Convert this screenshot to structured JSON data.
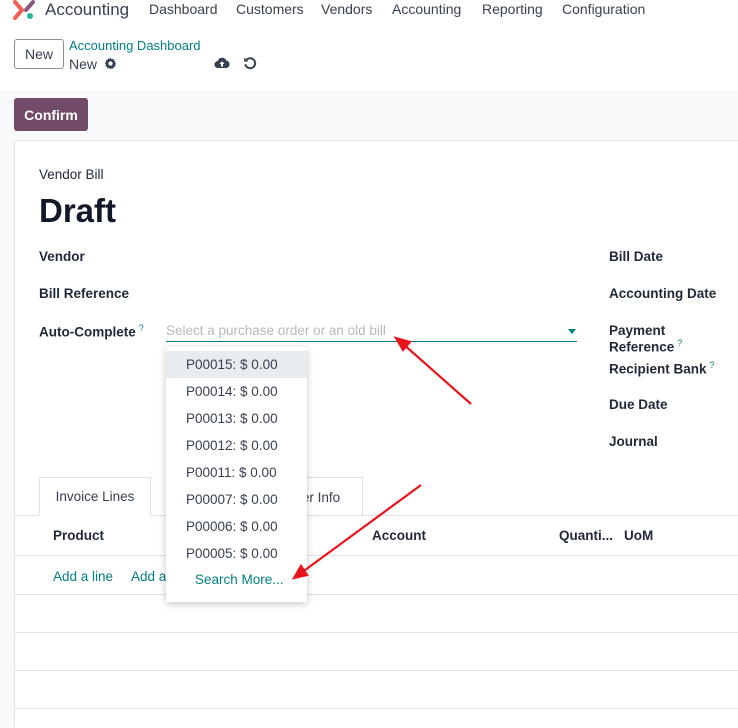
{
  "navbar": {
    "app_name": "Accounting",
    "items": [
      {
        "label": "Dashboard"
      },
      {
        "label": "Customers"
      },
      {
        "label": "Vendors"
      },
      {
        "label": "Accounting"
      },
      {
        "label": "Reporting"
      },
      {
        "label": "Configuration"
      }
    ]
  },
  "control": {
    "new_label": "New",
    "breadcrumb_parent": "Accounting Dashboard",
    "breadcrumb_current": "New"
  },
  "actions": {
    "confirm_label": "Confirm"
  },
  "form": {
    "doc_type": "Vendor Bill",
    "status_title": "Draft",
    "left_fields": {
      "vendor": "Vendor",
      "bill_reference": "Bill Reference",
      "auto_complete": "Auto-Complete",
      "auto_complete_help": "?"
    },
    "auto_complete_placeholder": "Select a purchase order or an old bill",
    "right_fields": {
      "bill_date": "Bill Date",
      "accounting_date": "Accounting Date",
      "payment_reference": "Payment Reference",
      "payment_reference_help": "?",
      "recipient_bank": "Recipient Bank",
      "recipient_bank_help": "?",
      "due_date": "Due Date",
      "journal": "Journal"
    }
  },
  "tabs": {
    "invoice_lines": "Invoice Lines",
    "other_info_partial": "er Info"
  },
  "table": {
    "columns": {
      "product": "Product",
      "account": "Account",
      "quantity": "Quanti...",
      "uom": "UoM"
    },
    "add_line": "Add a line",
    "add_section_partial": "Add a"
  },
  "dropdown": {
    "items": [
      "P00015: $ 0.00",
      "P00014: $ 0.00",
      "P00013: $ 0.00",
      "P00012: $ 0.00",
      "P00011: $ 0.00",
      "P00007: $ 0.00",
      "P00006: $ 0.00",
      "P00005: $ 0.00"
    ],
    "search_more": "Search More..."
  },
  "colors": {
    "brand": "#714b67",
    "link": "#017e84",
    "annotation_arrow": "#e8141b"
  },
  "icons": {
    "logo": "odoo-logo-icon",
    "gear": "gear-icon",
    "save": "cloud-upload-icon",
    "discard": "undo-icon",
    "dropdown": "caret-down-icon"
  }
}
